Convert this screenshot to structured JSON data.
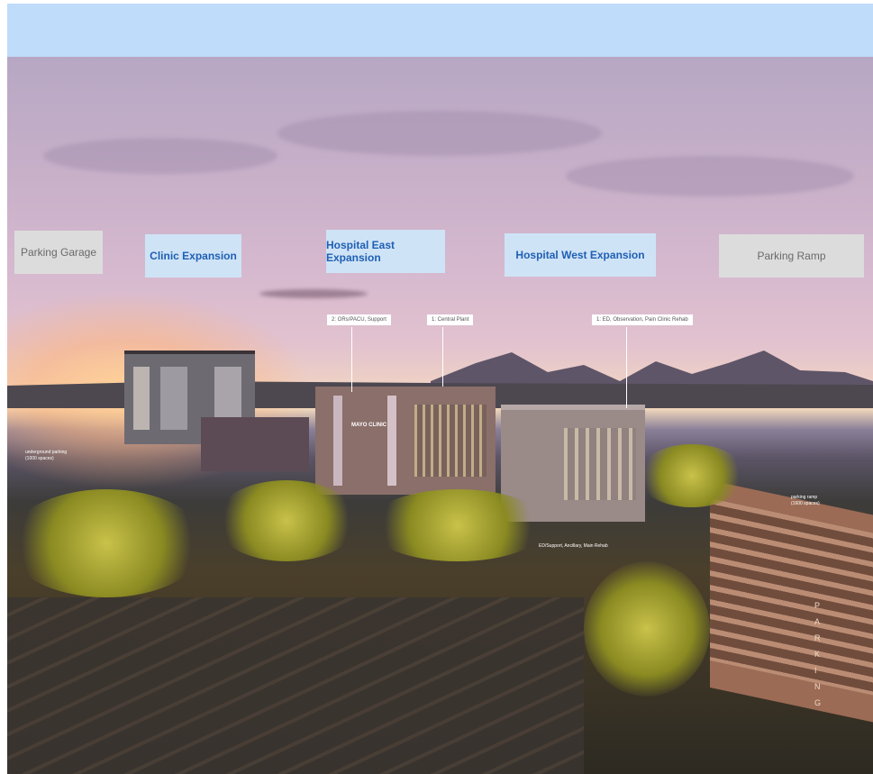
{
  "labels": {
    "parking_garage": "Parking Garage",
    "clinic_expansion": "Clinic Expansion",
    "hospital_east": "Hospital East Expansion",
    "hospital_west": "Hospital West Expansion",
    "parking_ramp": "Parking Ramp"
  },
  "callouts": {
    "ors_support": "2: ORs/PACU, Support",
    "central_plant": "1: Central Plant",
    "ed_observation": "1: ED, Observation, Pain Clinic Rehab",
    "parking_note": "parking ramp\n(1600 spaces)",
    "underground_note": "underground parking\n(1000 spaces)",
    "ed_bottom": "ED/Support, Ancillary, Main Rehab"
  },
  "signage": {
    "building_sign": "MAYO CLINIC",
    "parking_vertical": "PARKING"
  },
  "colors": {
    "topbar": "#bfdcfb",
    "label_blue_bg": "#cfe3f6",
    "label_blue_text": "#1f5fb4",
    "label_gray_bg": "#dcdcdc"
  }
}
